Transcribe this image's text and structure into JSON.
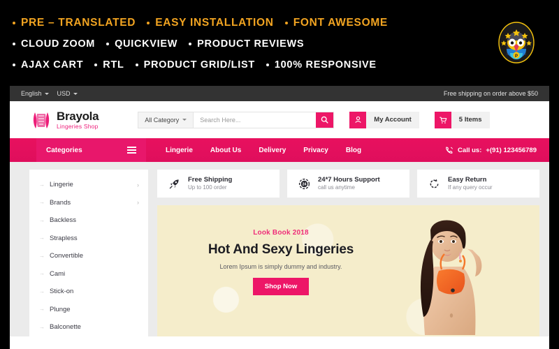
{
  "promo": {
    "rows": [
      {
        "items": [
          "PRE – TRANSLATED",
          "EASY INSTALLATION",
          "FONT AWESOME"
        ]
      },
      {
        "items": [
          "CLOUD ZOOM",
          "QUICKVIEW",
          "PRODUCT REVIEWS"
        ]
      },
      {
        "items": [
          "AJAX CART",
          "RTL",
          "PRODUCT GRID/LIST",
          "100% RESPONSIVE"
        ]
      }
    ],
    "accent_color": "#F2A421",
    "text_color": "#FFFFFF",
    "background": "#000000",
    "mascot_icon": "penguin-mascot-logo"
  },
  "topbar": {
    "language": "English",
    "currency": "USD",
    "shipping_notice": "Free shipping on order above $50"
  },
  "header": {
    "logo_icon": "corset-lingerie-icon",
    "logo_name": "Brayola",
    "logo_tagline": "Lingeries Shop",
    "category_select": "All Category",
    "search_placeholder": "Search Here...",
    "search_value": "",
    "search_icon": "search-icon",
    "account_icon": "user-icon",
    "account_label": "My Account",
    "cart_icon": "shopping-cart-icon",
    "cart_label": "5 Items"
  },
  "nav": {
    "categories_label": "Categories",
    "menu_icon": "hamburger-menu-icon",
    "links": [
      "Lingerie",
      "About Us",
      "Delivery",
      "Privacy",
      "Blog"
    ],
    "phone_icon": "phone-icon",
    "call_label": "Call us:",
    "phone_number": "+(91) 123456789",
    "accent_color": "#E8176B"
  },
  "sidebar": {
    "items": [
      {
        "label": "Lingerie",
        "has_submenu": true
      },
      {
        "label": "Brands",
        "has_submenu": true
      },
      {
        "label": "Backless",
        "has_submenu": false
      },
      {
        "label": "Strapless",
        "has_submenu": false
      },
      {
        "label": "Convertible",
        "has_submenu": false
      },
      {
        "label": "Cami",
        "has_submenu": false
      },
      {
        "label": "Stick-on",
        "has_submenu": false
      },
      {
        "label": "Plunge",
        "has_submenu": false
      },
      {
        "label": "Balconette",
        "has_submenu": false
      }
    ]
  },
  "services": [
    {
      "icon": "rocket-icon",
      "title": "Free Shipping",
      "subtitle": "Up to 100 order"
    },
    {
      "icon": "clock-24-icon",
      "title": "24*7 Hours Support",
      "subtitle": "call us anytime"
    },
    {
      "icon": "return-arrow-icon",
      "title": "Easy Return",
      "subtitle": "If any query occur"
    }
  ],
  "banner": {
    "eyebrow": "Look Book 2018",
    "title": "Hot And Sexy Lingeries",
    "subtitle": "Lorem Ipsum is simply dummy and industry.",
    "button_label": "Shop Now",
    "background_color": "#F5EDCB",
    "model_image": "female-model-orange-bikini"
  }
}
